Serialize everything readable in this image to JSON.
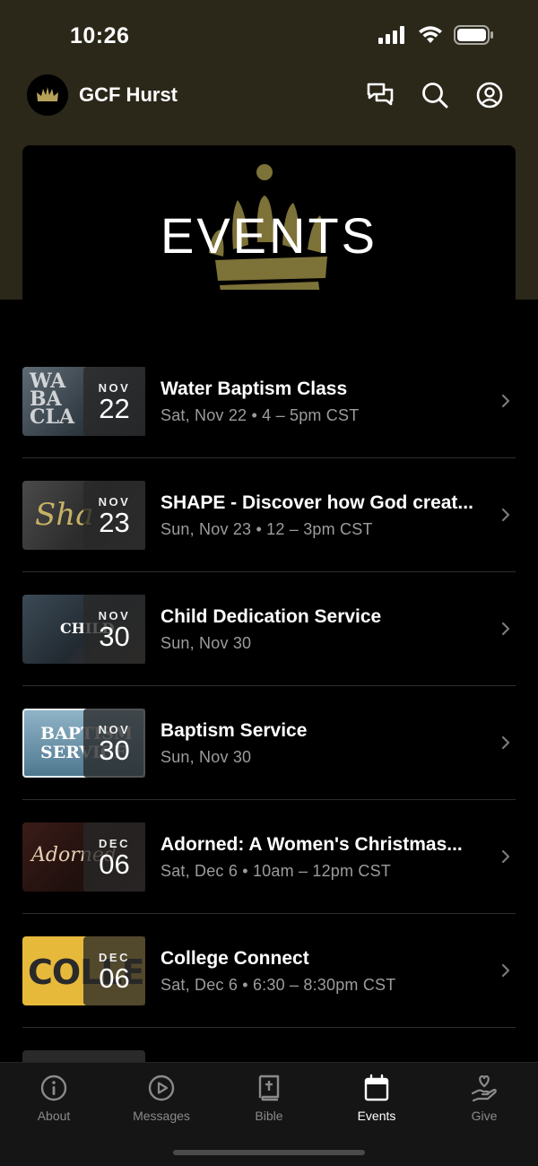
{
  "status": {
    "time": "10:26"
  },
  "header": {
    "title": "GCF Hurst"
  },
  "hero": {
    "title": "EVENTS"
  },
  "events": [
    {
      "month": "NOV",
      "day": "22",
      "title": "Water Baptism Class",
      "time": "Sat, Nov 22 • 4 – 5pm CST",
      "thumb_text": "WA BA CLA"
    },
    {
      "month": "NOV",
      "day": "23",
      "title": "SHAPE - Discover how God creat...",
      "time": "Sun, Nov 23 • 12 – 3pm CST",
      "thumb_text": "Sha"
    },
    {
      "month": "NOV",
      "day": "30",
      "title": "Child Dedication Service",
      "time": "Sun, Nov 30",
      "thumb_text": "CHILD"
    },
    {
      "month": "NOV",
      "day": "30",
      "title": "Baptism Service",
      "time": "Sun, Nov 30",
      "thumb_text": "BAPTISM SERVICE"
    },
    {
      "month": "DEC",
      "day": "06",
      "title": "Adorned: A Women's Christmas...",
      "time": "Sat, Dec 6 • 10am – 12pm CST",
      "thumb_text": "Adorned"
    },
    {
      "month": "DEC",
      "day": "06",
      "title": "College Connect",
      "time": "Sat, Dec 6 • 6:30 – 8:30pm CST",
      "thumb_text": "COLLEGE"
    }
  ],
  "tabs": [
    {
      "label": "About",
      "icon": "info-icon"
    },
    {
      "label": "Messages",
      "icon": "play-icon"
    },
    {
      "label": "Bible",
      "icon": "bible-icon"
    },
    {
      "label": "Events",
      "icon": "calendar-icon",
      "active": true
    },
    {
      "label": "Give",
      "icon": "give-icon"
    }
  ],
  "colors": {
    "header_bg": "#2b2719",
    "crown_gold": "#7d7238",
    "tab_active": "#ffffff",
    "tab_inactive": "#8a8a8a"
  }
}
